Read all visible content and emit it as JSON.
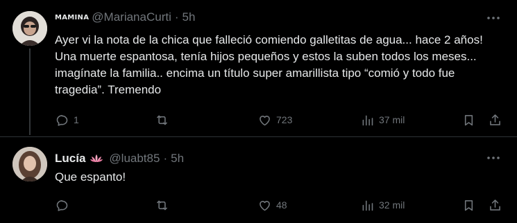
{
  "tweet1": {
    "name_tag": "MAMINA",
    "handle": "@MarianaCurti",
    "separator": "·",
    "time": "5h",
    "text": "Ayer vi la nota de la chica que falleció comiendo galletitas de agua... hace 2 años! Una muerte espantosa, tenía hijos pequeños y estos la suben todos los meses... imagínate la familia.. encima un título super amarillista tipo “comió y todo fue tragedia”. Tremendo",
    "replies": "1",
    "retweets": "",
    "likes": "723",
    "views": "37 mil"
  },
  "tweet2": {
    "name": "Lucía",
    "handle": "@luabt85",
    "separator": "·",
    "time": "5h",
    "text": "Que espanto!",
    "replies": "",
    "retweets": "",
    "likes": "48",
    "views": "32 mil"
  },
  "icons": {
    "reply": "reply-icon",
    "retweet": "retweet-icon",
    "like": "heart-icon",
    "views": "views-icon",
    "bookmark": "bookmark-icon",
    "share": "share-icon",
    "more": "more-icon",
    "lotus": "lotus-icon"
  },
  "colors": {
    "background": "#000000",
    "text_primary": "#e7e9ea",
    "text_secondary": "#71767b",
    "divider": "#2f3336",
    "lotus": "#f4a6c0"
  }
}
